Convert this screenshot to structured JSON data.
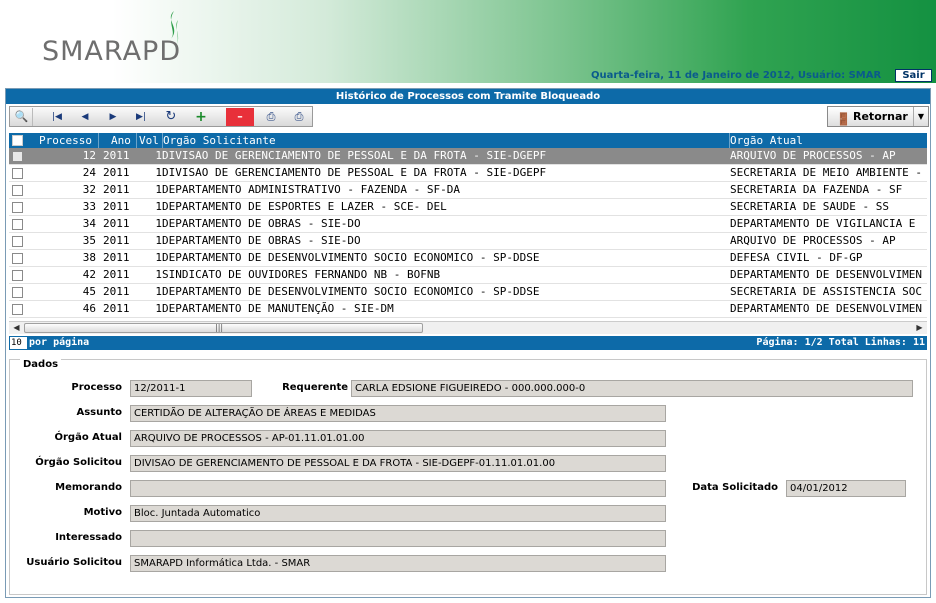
{
  "header": {
    "logo_text": "SMARAPD",
    "status": "Quarta-feira, 11 de Janeiro de 2012, Usuário: SMAR",
    "logout_label": "Sair"
  },
  "panel": {
    "title": "Histórico de Processos com Tramite Bloqueado",
    "return_label": "Retornar"
  },
  "toolbar": {
    "icons": [
      "search-icon",
      "first-page-icon",
      "prev-page-icon",
      "next-page-icon",
      "last-page-icon",
      "refresh-icon",
      "add-icon",
      "remove-icon",
      "print-icon",
      "print-preview-icon"
    ]
  },
  "table": {
    "columns": [
      "Processo",
      "Ano",
      "Vol",
      "Orgão Solicitante",
      "Orgão Atual"
    ],
    "rows": [
      {
        "processo": "12",
        "ano": "2011",
        "vol": "1",
        "solicitante": "DIVISAO DE GERENCIAMENTO DE PESSOAL E DA FROTA - SIE-DGEPF",
        "atual": "ARQUIVO DE PROCESSOS - AP",
        "selected": true
      },
      {
        "processo": "24",
        "ano": "2011",
        "vol": "1",
        "solicitante": "DIVISAO DE GERENCIAMENTO DE PESSOAL E DA FROTA - SIE-DGEPF",
        "atual": "SECRETARIA DE MEIO AMBIENTE -",
        "selected": false
      },
      {
        "processo": "32",
        "ano": "2011",
        "vol": "1",
        "solicitante": "DEPARTAMENTO ADMINISTRATIVO - FAZENDA - SF-DA",
        "atual": "SECRETARIA DA FAZENDA - SF",
        "selected": false
      },
      {
        "processo": "33",
        "ano": "2011",
        "vol": "1",
        "solicitante": "DEPARTAMENTO DE ESPORTES E LAZER - SCE- DEL",
        "atual": "SECRETARIA DE SAUDE - SS",
        "selected": false
      },
      {
        "processo": "34",
        "ano": "2011",
        "vol": "1",
        "solicitante": "DEPARTAMENTO DE OBRAS - SIE-DO",
        "atual": "DEPARTAMENTO DE VIGILANCIA E",
        "selected": false
      },
      {
        "processo": "35",
        "ano": "2011",
        "vol": "1",
        "solicitante": "DEPARTAMENTO DE OBRAS - SIE-DO",
        "atual": "ARQUIVO DE PROCESSOS - AP",
        "selected": false
      },
      {
        "processo": "38",
        "ano": "2011",
        "vol": "1",
        "solicitante": "DEPARTAMENTO DE DESENVOLVIMENTO SOCIO ECONOMICO - SP-DDSE",
        "atual": "DEFESA CIVIL - DF-GP",
        "selected": false
      },
      {
        "processo": "42",
        "ano": "2011",
        "vol": "1",
        "solicitante": "SINDICATO DE OUVIDORES FERNANDO NB - BOFNB",
        "atual": "DEPARTAMENTO DE DESENVOLVIMEN",
        "selected": false
      },
      {
        "processo": "45",
        "ano": "2011",
        "vol": "1",
        "solicitante": "DEPARTAMENTO DE DESENVOLVIMENTO SOCIO ECONOMICO - SP-DDSE",
        "atual": "SECRETARIA DE ASSISTENCIA SOC",
        "selected": false
      },
      {
        "processo": "46",
        "ano": "2011",
        "vol": "1",
        "solicitante": "DEPARTAMENTO DE MANUTENÇÃO - SIE-DM",
        "atual": "DEPARTAMENTO DE DESENVOLVIMEN",
        "selected": false
      }
    ]
  },
  "pager": {
    "per_page": "10",
    "per_page_label": "por página",
    "page_info": "Página: 1/2 Total Linhas: 11"
  },
  "details": {
    "legend": "Dados",
    "processo_label": "Processo",
    "processo": "12/2011-1",
    "requerente_label": "Requerente",
    "requerente": "CARLA EDSIONE FIGUEIREDO - 000.000.000-0",
    "assunto_label": "Assunto",
    "assunto": "CERTIDÃO DE ALTERAÇÃO DE ÁREAS E MEDIDAS",
    "orgao_atual_label": "Órgão Atual",
    "orgao_atual": "ARQUIVO DE PROCESSOS - AP-01.11.01.01.00",
    "orgao_solicitou_label": "Órgão Solicitou",
    "orgao_solicitou": "DIVISAO DE GERENCIAMENTO DE PESSOAL E DA FROTA - SIE-DGEPF-01.11.01.01.00",
    "memorando_label": "Memorando",
    "memorando": "",
    "data_label": "Data Solicitado",
    "data": "04/01/2012",
    "motivo_label": "Motivo",
    "motivo": "Bloc. Juntada Automatico",
    "interessado_label": "Interessado",
    "interessado": "",
    "usuario_label": "Usuário Solicitou",
    "usuario": "SMARAPD Informática Ltda. - SMAR"
  }
}
